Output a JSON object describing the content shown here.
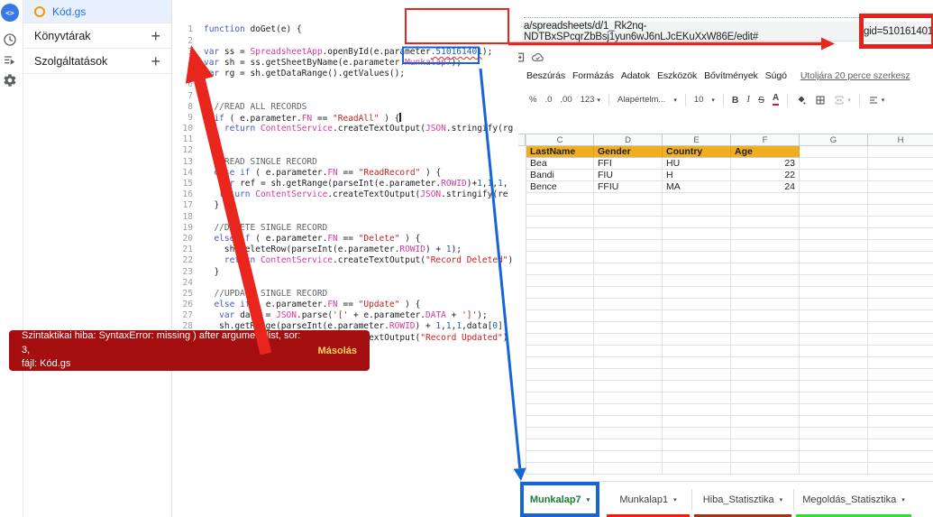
{
  "annotation_colors": {
    "red": "#e8261d",
    "blue": "#1665d8"
  },
  "apps_script": {
    "rail": {
      "editor_glyph": "<>"
    },
    "files": {
      "selected": "Kód.gs"
    },
    "sections": [
      {
        "label": "Könyvtárak",
        "action": "+"
      },
      {
        "label": "Szolgáltatások",
        "action": "+"
      }
    ],
    "code": {
      "lines": [
        [
          [
            "k",
            "function"
          ],
          [
            "p",
            " doGet(e) {"
          ]
        ],
        [],
        [
          [
            "k",
            "var"
          ],
          [
            "p",
            " ss = "
          ],
          [
            "t",
            "SpreadsheetApp"
          ],
          [
            "p",
            ".openById(e.parameter"
          ],
          [
            "e",
            ".510161401"
          ],
          [
            "p",
            ");"
          ]
        ],
        [
          [
            "k",
            "var"
          ],
          [
            "p",
            " sh = ss.getSheetByName(e.parameter"
          ],
          [
            "t",
            ".Munkalap7"
          ],
          [
            "p",
            ");"
          ]
        ],
        [
          [
            "k",
            "var"
          ],
          [
            "p",
            " rg = sh.getDataRange().getValues();"
          ]
        ],
        [],
        [],
        [
          [
            "c",
            "  //READ ALL RECORDS"
          ]
        ],
        [
          [
            "p",
            "  "
          ],
          [
            "k",
            "if"
          ],
          [
            "p",
            " ( e.parameter."
          ],
          [
            "t",
            "FN"
          ],
          [
            "p",
            " == "
          ],
          [
            "s",
            "\"ReadAll\""
          ],
          [
            "p",
            " ) {"
          ],
          [
            "cur",
            ""
          ]
        ],
        [
          [
            "p",
            "    "
          ],
          [
            "k",
            "return"
          ],
          [
            "p",
            " "
          ],
          [
            "t",
            "ContentService"
          ],
          [
            "p",
            ".createTextOutput("
          ],
          [
            "t",
            "JSON"
          ],
          [
            "p",
            ".stringify(rg"
          ]
        ],
        [
          [
            "p",
            "  }"
          ]
        ],
        [],
        [
          [
            "c",
            "  //READ SINGLE RECORD"
          ]
        ],
        [
          [
            "p",
            "  "
          ],
          [
            "k",
            "else"
          ],
          [
            "p",
            " "
          ],
          [
            "k",
            "if"
          ],
          [
            "p",
            " ( e.parameter."
          ],
          [
            "t",
            "FN"
          ],
          [
            "p",
            " == "
          ],
          [
            "s",
            "\"ReadRecord\""
          ],
          [
            "p",
            " ) {"
          ]
        ],
        [
          [
            "p",
            "   "
          ],
          [
            "k",
            "var"
          ],
          [
            "p",
            " ref = sh.getRange(parseInt(e.parameter."
          ],
          [
            "t",
            "ROWID"
          ],
          [
            "p",
            ")+"
          ],
          [
            "n",
            "1"
          ],
          [
            "p",
            ","
          ],
          [
            "n",
            "1"
          ],
          [
            "p",
            ","
          ],
          [
            "n",
            "1"
          ],
          [
            "p",
            ","
          ]
        ],
        [
          [
            "p",
            "   "
          ],
          [
            "k",
            "return"
          ],
          [
            "p",
            " "
          ],
          [
            "t",
            "ContentService"
          ],
          [
            "p",
            ".createTextOutput("
          ],
          [
            "t",
            "JSON"
          ],
          [
            "p",
            ".stringify(re"
          ]
        ],
        [
          [
            "p",
            "  }"
          ]
        ],
        [],
        [
          [
            "c",
            "  //DELETE SINGLE RECORD"
          ]
        ],
        [
          [
            "p",
            "  "
          ],
          [
            "k",
            "else"
          ],
          [
            "p",
            " "
          ],
          [
            "k",
            "if"
          ],
          [
            "p",
            " ( e.parameter."
          ],
          [
            "t",
            "FN"
          ],
          [
            "p",
            " == "
          ],
          [
            "s",
            "\"Delete\""
          ],
          [
            "p",
            " ) {"
          ]
        ],
        [
          [
            "p",
            "    sh.deleteRow(parseInt(e.parameter."
          ],
          [
            "t",
            "ROWID"
          ],
          [
            "p",
            ") + "
          ],
          [
            "n",
            "1"
          ],
          [
            "p",
            ");"
          ]
        ],
        [
          [
            "p",
            "    "
          ],
          [
            "k",
            "return"
          ],
          [
            "p",
            " "
          ],
          [
            "t",
            "ContentService"
          ],
          [
            "p",
            ".createTextOutput("
          ],
          [
            "s",
            "\"Record Deleted\""
          ],
          [
            "p",
            ")"
          ]
        ],
        [
          [
            "p",
            "  }"
          ]
        ],
        [],
        [
          [
            "c",
            "  //UPDATE SINGLE RECORD"
          ]
        ],
        [
          [
            "p",
            "  "
          ],
          [
            "k",
            "else"
          ],
          [
            "p",
            " "
          ],
          [
            "k",
            "if"
          ],
          [
            "p",
            " ( e.parameter."
          ],
          [
            "t",
            "FN"
          ],
          [
            "p",
            " == "
          ],
          [
            "s",
            "\"Update\""
          ],
          [
            "p",
            " ) {"
          ]
        ],
        [
          [
            "p",
            "   "
          ],
          [
            "k",
            "var"
          ],
          [
            "p",
            " data = "
          ],
          [
            "t",
            "JSON"
          ],
          [
            "p",
            ".parse("
          ],
          [
            "s",
            "'['"
          ],
          [
            "p",
            " + e.parameter."
          ],
          [
            "t",
            "DATA"
          ],
          [
            "p",
            " + "
          ],
          [
            "s",
            "']'"
          ],
          [
            "p",
            ");"
          ]
        ],
        [
          [
            "p",
            "   sh.getRange(parseInt(e.parameter."
          ],
          [
            "t",
            "ROWID"
          ],
          [
            "p",
            ") + "
          ],
          [
            "n",
            "1"
          ],
          [
            "p",
            ","
          ],
          [
            "n",
            "1"
          ],
          [
            "p",
            ","
          ],
          [
            "n",
            "1"
          ],
          [
            "p",
            ",data["
          ],
          [
            "n",
            "0"
          ],
          [
            "p",
            "]."
          ]
        ],
        [
          [
            "p",
            "   "
          ],
          [
            "k",
            "return"
          ],
          [
            "p",
            " "
          ],
          [
            "t",
            "ContentService"
          ],
          [
            "p",
            ".createTextOutput("
          ],
          [
            "s",
            "\"Record Updated\""
          ],
          [
            "p",
            ")"
          ]
        ]
      ]
    },
    "toast": {
      "message_line1": "Szintaktikai hiba: SyntaxError: missing ) after argument list, sor: 3,",
      "message_line2": "fájl: Kód.gs",
      "action": "Másolás"
    }
  },
  "sheets": {
    "url": {
      "prefix": "a/spreadsheets/d/1_Rk2nq-NDTBxSPcqrZbBsj1yun6wJ6nLJcEKuXxW86E/edit#",
      "gid": "gid=510161401"
    },
    "menus": [
      "Beszúrás",
      "Formázás",
      "Adatok",
      "Eszközök",
      "Bővítmények",
      "Súgó"
    ],
    "last_edited": "Utoljára 20 perce szerkesz",
    "toolbar": {
      "percent": "%",
      "decrease_decimal": ".0",
      "increase_decimal": ".00",
      "more_formats": "123",
      "font_name": "Alapértelm...",
      "font_size": "10",
      "bold": "B",
      "italic": "I",
      "strikethrough": "S",
      "text_color": "A"
    },
    "columns": [
      "C",
      "D",
      "E",
      "F",
      "G",
      "H"
    ],
    "table": {
      "header_bg": "#efaf20",
      "headers": [
        "LastName",
        "Gender",
        "Country",
        "Age"
      ],
      "rows": [
        [
          "Bea",
          "FFI",
          "HU",
          "23"
        ],
        [
          "Bandi",
          "FIU",
          "H",
          "22"
        ],
        [
          "Bence",
          "FFIU",
          "MA",
          "24"
        ]
      ]
    },
    "empty_row_count": 24,
    "tabs": [
      {
        "label": "Munkalap7",
        "color": "#188038",
        "active": true
      },
      {
        "label": "Munkalap1",
        "underline": "#f01d0d"
      },
      {
        "label": "Hiba_Statisztika",
        "underline": "#a23514"
      },
      {
        "label": "Megoldás_Statisztika",
        "underline": "#2fdf2f"
      }
    ]
  }
}
